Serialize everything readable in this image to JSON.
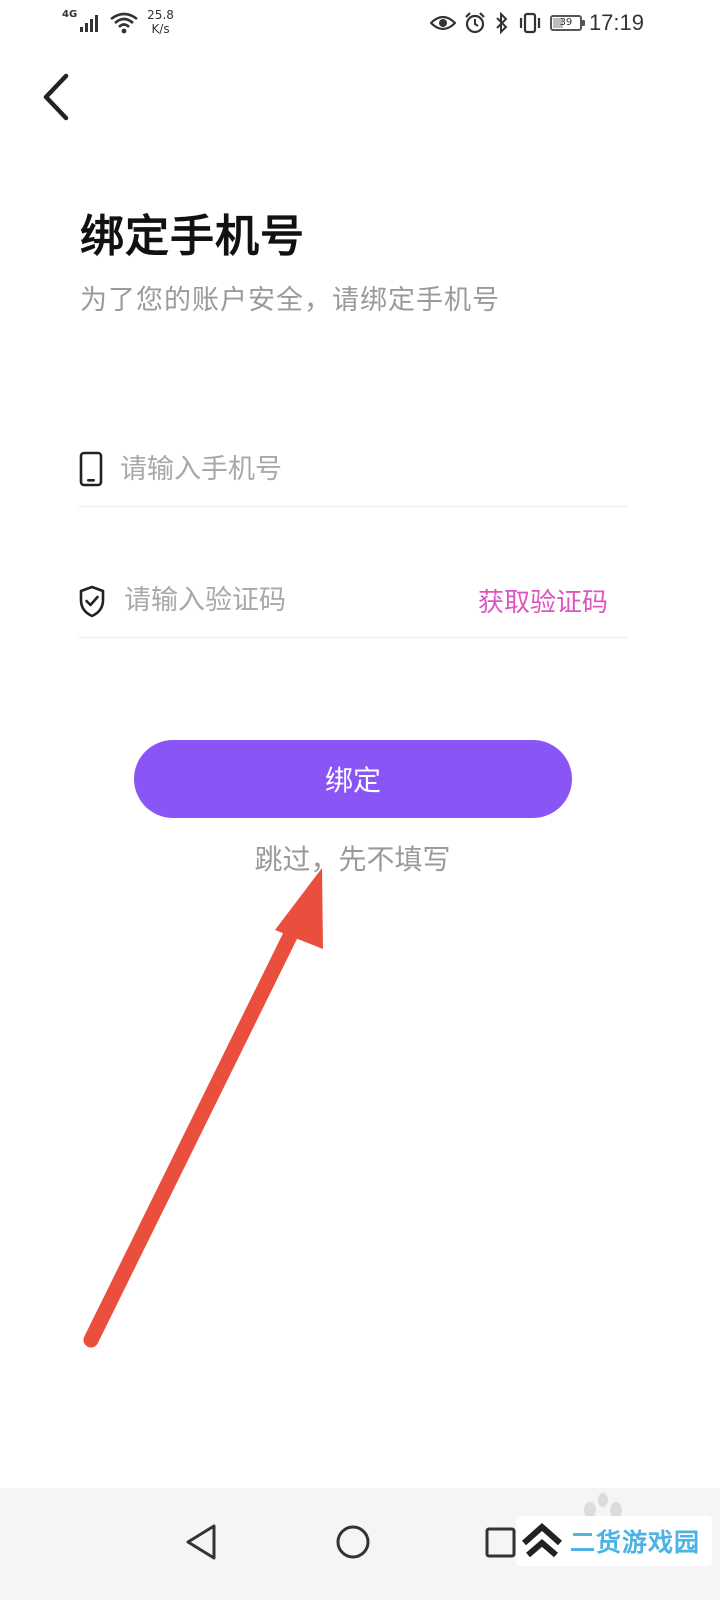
{
  "status_bar": {
    "network_type": "4G",
    "speed_value": "25.8",
    "speed_unit": "K/s",
    "battery_level": "39",
    "battery_percent": 39,
    "time": "17:19"
  },
  "header": {
    "back_icon": "chevron-left-icon"
  },
  "page": {
    "title": "绑定手机号",
    "subtitle": "为了您的账户安全，请绑定手机号"
  },
  "form": {
    "phone_placeholder": "请输入手机号",
    "phone_value": "",
    "code_placeholder": "请输入验证码",
    "code_value": "",
    "get_code_label": "获取验证码"
  },
  "actions": {
    "bind_label": "绑定",
    "skip_label": "跳过，先不填写"
  },
  "navigation": {
    "back_icon": "triangle-back-icon",
    "home_icon": "circle-home-icon",
    "recent_icon": "square-recent-icon"
  },
  "watermark": {
    "text": "二货游戏园"
  },
  "colors": {
    "accent": "#8a55f6",
    "link": "#dd55c3",
    "arrow": "#ea4e3d",
    "watermark": "#4db3e4"
  }
}
